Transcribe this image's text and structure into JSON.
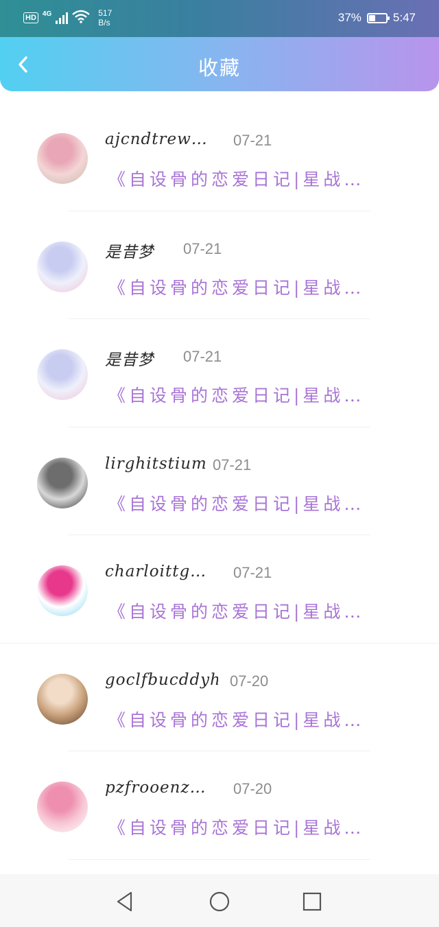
{
  "status_bar": {
    "hd_label": "HD",
    "network_type": "4G",
    "speed_value": "517",
    "speed_unit": "B/s",
    "battery_percent": "37%",
    "battery_level": 0.37,
    "time": "5:47"
  },
  "header": {
    "title": "收藏",
    "back_icon": "chevron-left-icon"
  },
  "items": [
    {
      "username": "ajcndtrew…",
      "date": "07-21",
      "excerpt": "《自设骨的恋爱日记|星战…",
      "avatar_colors": [
        "#f3d6d6",
        "#e9a6b6",
        "#c9b9a9"
      ]
    },
    {
      "username": "是昔梦",
      "date": "07-21",
      "excerpt": "《自设骨的恋爱日记|星战…",
      "avatar_colors": [
        "#eef0fb",
        "#c8ccf0",
        "#f3c2d6"
      ]
    },
    {
      "username": "是昔梦",
      "date": "07-21",
      "excerpt": "《自设骨的恋爱日记|星战…",
      "avatar_colors": [
        "#eef0fb",
        "#c8ccf0",
        "#f3c2d6"
      ]
    },
    {
      "username": "lirghitstium",
      "date": "07-21",
      "excerpt": "《自设骨的恋爱日记|星战…",
      "avatar_colors": [
        "#d8d8d8",
        "#6d6d6d",
        "#2a2a2a"
      ]
    },
    {
      "username": "charloittg…",
      "date": "07-21",
      "excerpt": "《自设骨的恋爱日记|星战…",
      "avatar_colors": [
        "#ffffff",
        "#e8388b",
        "#7fd4f0"
      ]
    },
    {
      "username": "goclfbucddyh",
      "date": "07-20",
      "excerpt": "《自设骨的恋爱日记|星战…",
      "avatar_colors": [
        "#c9a27c",
        "#f2dcc8",
        "#5a3b2a"
      ]
    },
    {
      "username": "pzfrooenz…",
      "date": "07-20",
      "excerpt": "《自设骨的恋爱日记|星战…",
      "avatar_colors": [
        "#f7c6d3",
        "#ee8fb0",
        "#ffffff"
      ]
    }
  ],
  "nav_bar": {
    "back_icon": "triangle-back-icon",
    "home_icon": "circle-home-icon",
    "recents_icon": "square-recents-icon"
  }
}
